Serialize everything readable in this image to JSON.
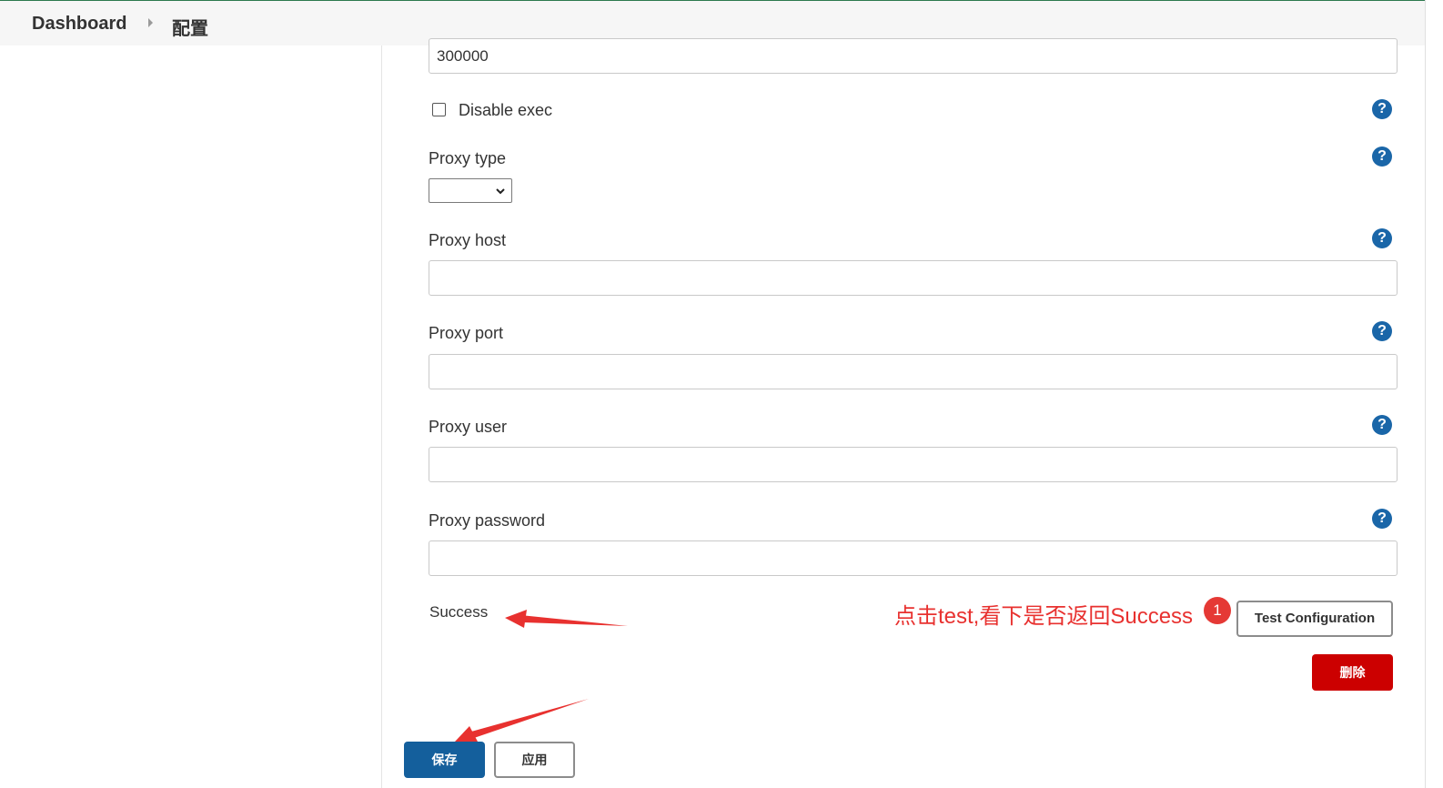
{
  "breadcrumb": {
    "home": "Dashboard",
    "current": "配置"
  },
  "timeout_field": {
    "value": "300000"
  },
  "disable_exec": {
    "label": "Disable exec",
    "checked": false
  },
  "proxy_type": {
    "label": "Proxy type",
    "selected": ""
  },
  "proxy_host": {
    "label": "Proxy host",
    "value": ""
  },
  "proxy_port": {
    "label": "Proxy port",
    "value": ""
  },
  "proxy_user": {
    "label": "Proxy user",
    "value": ""
  },
  "proxy_password": {
    "label": "Proxy password",
    "value": ""
  },
  "help_icon": {
    "glyph": "?"
  },
  "result": {
    "text": "Success"
  },
  "annotation": {
    "text": "点击test,看下是否返回Success",
    "badge": "1",
    "color": "#e8312f"
  },
  "buttons": {
    "test": "Test Configuration",
    "delete": "删除",
    "save": "保存",
    "apply": "应用"
  },
  "colors": {
    "primary": "#145f9c",
    "danger": "#cc0000",
    "help": "#1a66a8"
  }
}
